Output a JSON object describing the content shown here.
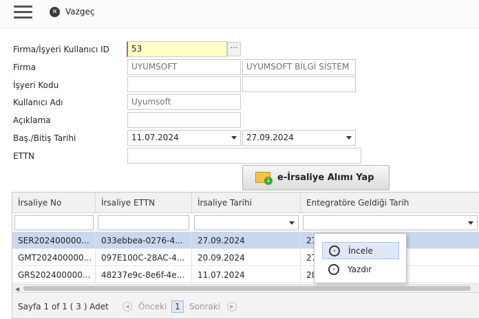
{
  "topbar": {
    "menu_icon": "hamburger-icon",
    "cancel_icon": "close-circle-icon",
    "cancel_label": "Vazgeç"
  },
  "form": {
    "labels": {
      "user_id": "Firma/İşyeri Kullanıcı ID",
      "company": "Firma",
      "workplace_code": "İşyeri Kodu",
      "username": "Kullanıcı Adı",
      "description": "Açıklama",
      "date_range": "Baş./Bitiş Tarihi",
      "ettn": "ETTN"
    },
    "values": {
      "user_id": "53",
      "company_code": "UYUMSOFT",
      "company_name": "UYUMSOFT BİLGİ SİSTEM",
      "workplace_code": "",
      "workplace_name": "",
      "username": "Uyumsoft",
      "description": "",
      "start_date": "11.07.2024",
      "end_date": "27.09.2024",
      "ettn": ""
    },
    "lookup_button": "···"
  },
  "action": {
    "receive_label": "e-İrsaliye Alımı Yap",
    "receive_icon": "envelope-download-icon"
  },
  "grid": {
    "columns": [
      "İrsaliye No",
      "İrsaliye ETTN",
      "İrsaliye Tarihi",
      "Entegratöre Geldiği Tarih"
    ],
    "rows": [
      [
        "SER202400000...",
        "033ebbea-0276-4...",
        "27.09.2024",
        "27"
      ],
      [
        "GMT202400000...",
        "097E100C-28AC-4...",
        "20.09.2024",
        "27"
      ],
      [
        "GRS202400000...",
        "48237e9c-8e6f-4e...",
        "11.07.2024",
        "28"
      ]
    ],
    "selected_row": 0
  },
  "pager": {
    "summary": "Sayfa 1 of 1 ( 3 ) Adet",
    "prev_label": "Önceki",
    "current_page": "1",
    "next_label": "Sonraki"
  },
  "context_menu": {
    "items": [
      {
        "label": "İncele",
        "icon": "chevron-right-circle-icon"
      },
      {
        "label": "Yazdır",
        "icon": "chevron-right-circle-icon"
      }
    ]
  }
}
